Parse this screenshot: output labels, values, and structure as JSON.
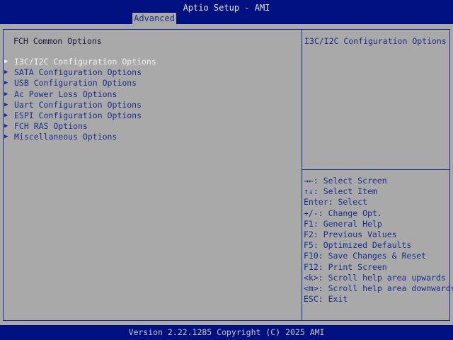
{
  "header": {
    "title": "Aptio Setup - AMI",
    "active_tab": "Advanced"
  },
  "main": {
    "section_title": "FCH Common Options",
    "items": [
      {
        "label": "I3C/I2C Configuration Options",
        "selected": true
      },
      {
        "label": "SATA Configuration Options",
        "selected": false
      },
      {
        "label": "USB Configuration Options",
        "selected": false
      },
      {
        "label": "Ac Power Loss Options",
        "selected": false
      },
      {
        "label": "Uart Configuration Options",
        "selected": false
      },
      {
        "label": "ESPI Configuration Options",
        "selected": false
      },
      {
        "label": "FCH RAS Options",
        "selected": false
      },
      {
        "label": "Miscellaneous Options",
        "selected": false
      }
    ],
    "item_icon": "right-triangle-icon"
  },
  "help": {
    "description": "I3C/I2C Configuration Options",
    "keys": [
      "→←: Select Screen",
      "↑↓: Select Item",
      "Enter: Select",
      "+/-: Change Opt.",
      "F1: General Help",
      "F2: Previous Values",
      "F5: Optimized Defaults",
      "F10: Save Changes & Reset",
      "F12: Print Screen",
      "<k>: Scroll help area upwards",
      "<m>: Scroll help area downwards",
      "ESC: Exit"
    ]
  },
  "footer": {
    "version": "Version 2.22.1285 Copyright (C) 2025 AMI"
  },
  "colors": {
    "background": "#a9a9a9",
    "bar": "#001080",
    "text": "#1d2d8c",
    "selected_text": "#f2f2f2",
    "border": "#1a2d96"
  }
}
